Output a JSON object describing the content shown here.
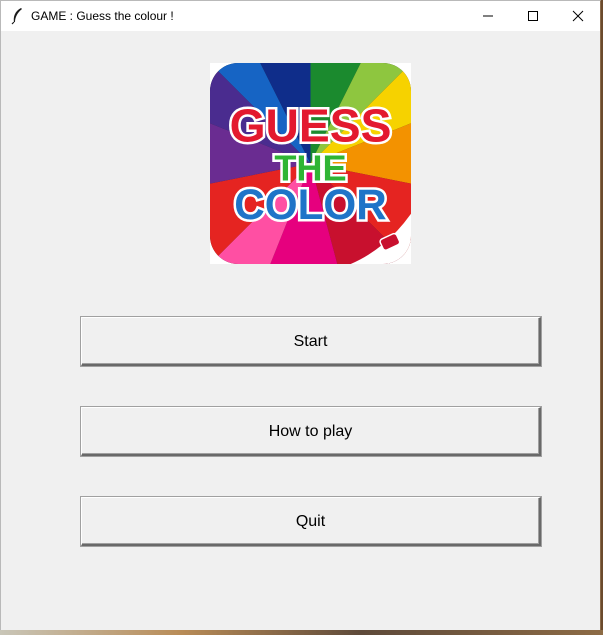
{
  "window": {
    "title": "GAME : Guess the colour !",
    "controls": {
      "minimize_icon": "minimize-icon",
      "maximize_icon": "maximize-icon",
      "close_icon": "close-icon"
    }
  },
  "logo": {
    "line1": "GUESS",
    "line2": "THE",
    "line3": "COLOR"
  },
  "menu": {
    "start_label": "Start",
    "how_to_play_label": "How to play",
    "quit_label": "Quit"
  },
  "colors": {
    "background": "#f0f0f0",
    "logo_red": "#e3192f",
    "logo_green": "#2fb534",
    "logo_blue": "#1f74c8"
  }
}
